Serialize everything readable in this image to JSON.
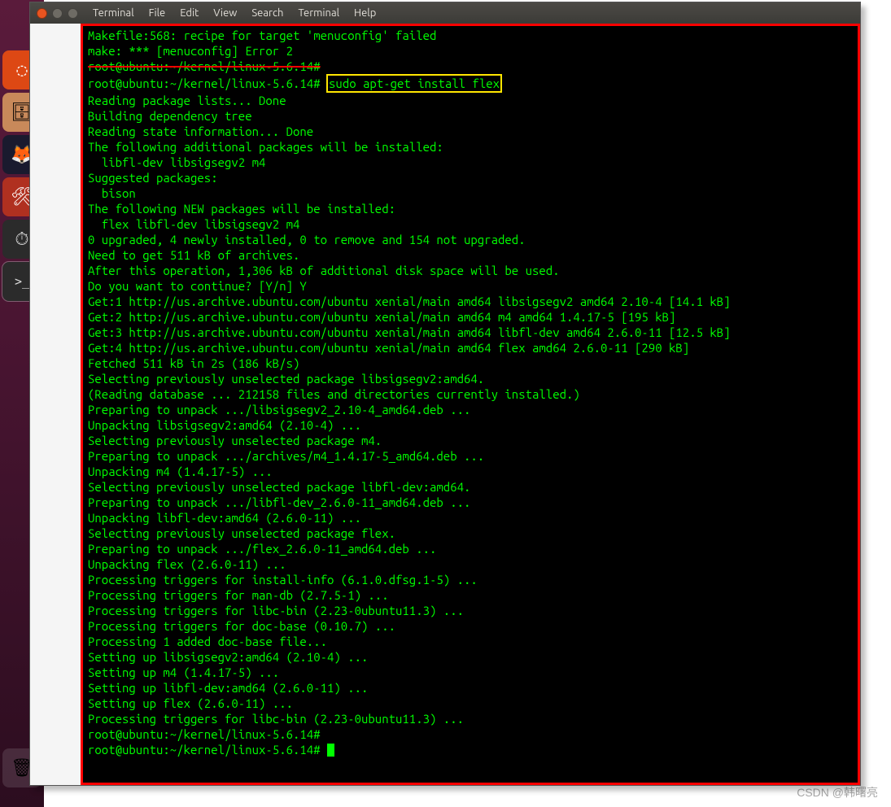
{
  "window": {
    "app_title": "Terminal"
  },
  "menu": {
    "items": [
      "Terminal",
      "File",
      "Edit",
      "View",
      "Search",
      "Terminal",
      "Help"
    ]
  },
  "launcher": {
    "icons": [
      {
        "name": "ubuntu-dash-icon",
        "glyph": "◌"
      },
      {
        "name": "files-icon",
        "glyph": "🗄"
      },
      {
        "name": "firefox-icon",
        "glyph": "🦊"
      },
      {
        "name": "settings-icon",
        "glyph": "🛠"
      },
      {
        "name": "system-monitor-icon",
        "glyph": "⏱"
      },
      {
        "name": "terminal-icon",
        "glyph": ">_"
      }
    ],
    "trash": {
      "name": "trash-icon",
      "glyph": "🗑"
    }
  },
  "terminal": {
    "prompt": "root@ubuntu:~/kernel/linux-5.6.14#",
    "highlight_command": "sudo apt-get install flex",
    "pre_lines": [
      "Makefile:568: recipe for target 'menuconfig' failed",
      "make: *** [menuconfig] Error 2"
    ],
    "struck_line": "root@ubuntu:~/kernel/linux-5.6.14#",
    "lines": [
      "Reading package lists... Done",
      "Building dependency tree",
      "Reading state information... Done",
      "The following additional packages will be installed:",
      "  libfl-dev libsigsegv2 m4",
      "Suggested packages:",
      "  bison",
      "The following NEW packages will be installed:",
      "  flex libfl-dev libsigsegv2 m4",
      "0 upgraded, 4 newly installed, 0 to remove and 154 not upgraded.",
      "Need to get 511 kB of archives.",
      "After this operation, 1,306 kB of additional disk space will be used.",
      "Do you want to continue? [Y/n] Y",
      "Get:1 http://us.archive.ubuntu.com/ubuntu xenial/main amd64 libsigsegv2 amd64 2.10-4 [14.1 kB]",
      "Get:2 http://us.archive.ubuntu.com/ubuntu xenial/main amd64 m4 amd64 1.4.17-5 [195 kB]",
      "Get:3 http://us.archive.ubuntu.com/ubuntu xenial/main amd64 libfl-dev amd64 2.6.0-11 [12.5 kB]",
      "Get:4 http://us.archive.ubuntu.com/ubuntu xenial/main amd64 flex amd64 2.6.0-11 [290 kB]",
      "Fetched 511 kB in 2s (186 kB/s)",
      "Selecting previously unselected package libsigsegv2:amd64.",
      "(Reading database ... 212158 files and directories currently installed.)",
      "Preparing to unpack .../libsigsegv2_2.10-4_amd64.deb ...",
      "Unpacking libsigsegv2:amd64 (2.10-4) ...",
      "Selecting previously unselected package m4.",
      "Preparing to unpack .../archives/m4_1.4.17-5_amd64.deb ...",
      "Unpacking m4 (1.4.17-5) ...",
      "Selecting previously unselected package libfl-dev:amd64.",
      "Preparing to unpack .../libfl-dev_2.6.0-11_amd64.deb ...",
      "Unpacking libfl-dev:amd64 (2.6.0-11) ...",
      "Selecting previously unselected package flex.",
      "Preparing to unpack .../flex_2.6.0-11_amd64.deb ...",
      "Unpacking flex (2.6.0-11) ...",
      "Processing triggers for install-info (6.1.0.dfsg.1-5) ...",
      "Processing triggers for man-db (2.7.5-1) ...",
      "Processing triggers for libc-bin (2.23-0ubuntu11.3) ...",
      "Processing triggers for doc-base (0.10.7) ...",
      "Processing 1 added doc-base file...",
      "Setting up libsigsegv2:amd64 (2.10-4) ...",
      "Setting up m4 (1.4.17-5) ...",
      "Setting up libfl-dev:amd64 (2.6.0-11) ...",
      "Setting up flex (2.6.0-11) ...",
      "Processing triggers for libc-bin (2.23-0ubuntu11.3) ...",
      "root@ubuntu:~/kernel/linux-5.6.14#",
      "root@ubuntu:~/kernel/linux-5.6.14# "
    ]
  },
  "watermark": "CSDN @韩曙亮"
}
